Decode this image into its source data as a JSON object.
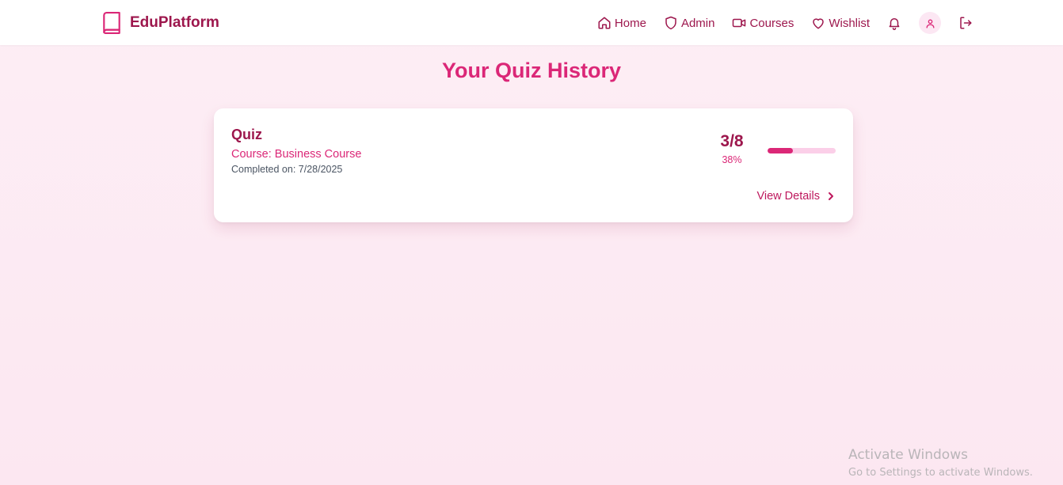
{
  "brand": {
    "name": "EduPlatform",
    "icon": "book-icon"
  },
  "nav": {
    "items": [
      {
        "label": "Home",
        "icon": "home-icon"
      },
      {
        "label": "Admin",
        "icon": "shield-icon"
      },
      {
        "label": "Courses",
        "icon": "video-icon"
      },
      {
        "label": "Wishlist",
        "icon": "heart-icon"
      }
    ],
    "notifications_icon": "bell-icon",
    "profile_icon": "user-icon",
    "logout_icon": "logout-icon"
  },
  "page": {
    "title": "Your Quiz History"
  },
  "quiz_history": [
    {
      "name": "Quiz",
      "course": "Course: Business Course",
      "completed": "Completed on: 7/28/2025",
      "score": "3/8",
      "percent_label": "38%",
      "progress_fraction": 0.375,
      "details_label": "View Details"
    }
  ],
  "colors": {
    "primary": "#db2777",
    "primary_dark": "#9d174d",
    "track": "#fbcfe8",
    "background": "#fdeef5"
  },
  "watermark": {
    "title": "Activate Windows",
    "subtitle": "Go to Settings to activate Windows."
  }
}
